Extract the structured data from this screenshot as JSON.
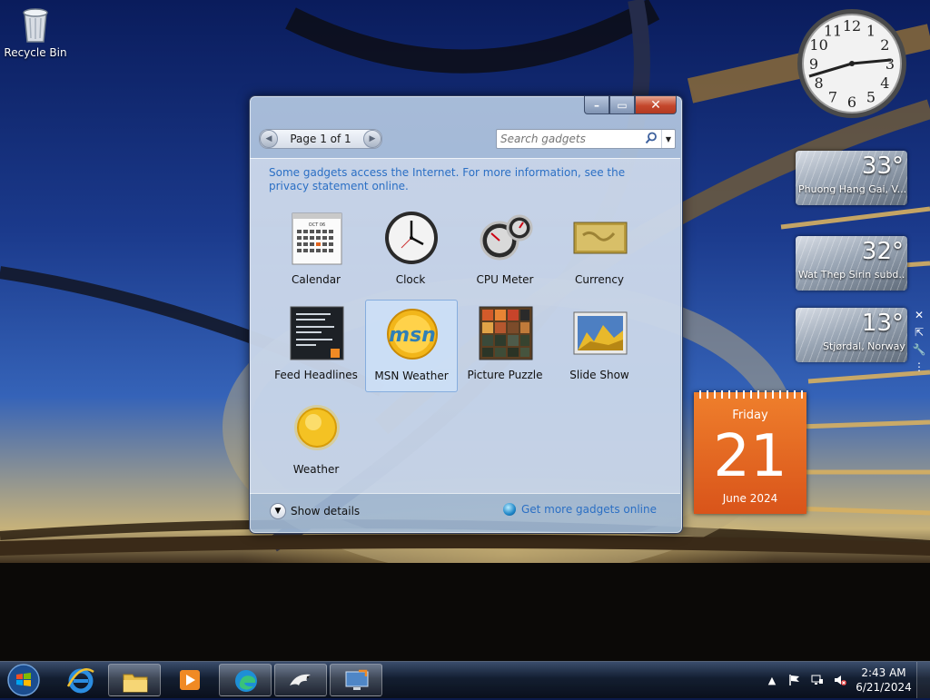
{
  "desktop": {
    "icons": [
      {
        "label": "Recycle Bin",
        "icon": "recycle-bin-icon"
      }
    ]
  },
  "gallery": {
    "caption": {
      "minimize": "–",
      "maximize": "▭",
      "close": "✕"
    },
    "pager": {
      "label": "Page 1 of 1",
      "prev": "◀",
      "next": "▶"
    },
    "search": {
      "placeholder": "Search gadgets",
      "dropdown": "▼"
    },
    "notice": "Some gadgets access the Internet.  For more information, see the privacy statement online.",
    "gadgets": [
      {
        "name": "Calendar",
        "icon": "calendar-gadget-icon"
      },
      {
        "name": "Clock",
        "icon": "clock-gadget-icon"
      },
      {
        "name": "CPU Meter",
        "icon": "cpu-meter-gadget-icon"
      },
      {
        "name": "Currency",
        "icon": "currency-gadget-icon"
      },
      {
        "name": "Feed Headlines",
        "icon": "feed-headlines-gadget-icon"
      },
      {
        "name": "MSN Weather",
        "icon": "msn-weather-gadget-icon",
        "selected": true
      },
      {
        "name": "Picture Puzzle",
        "icon": "picture-puzzle-gadget-icon"
      },
      {
        "name": "Slide Show",
        "icon": "slide-show-gadget-icon"
      },
      {
        "name": "Weather",
        "icon": "weather-gadget-icon"
      }
    ],
    "cal_thumb_label": "OCT 06",
    "msn_logo": "msn",
    "footer": {
      "show_details": "Show details",
      "more_gadgets": "Get more gadgets online"
    }
  },
  "sidebar": {
    "clock": {
      "numbers": [
        "12",
        "1",
        "2",
        "3",
        "4",
        "5",
        "6",
        "7",
        "8",
        "9",
        "10",
        "11"
      ]
    },
    "weather": [
      {
        "temp": "33°",
        "location": "Phuong Hang Gai, V..."
      },
      {
        "temp": "32°",
        "location": "Wat Thep Sirin subd..."
      },
      {
        "temp": "13°",
        "location": "Stjørdal, Norway"
      }
    ],
    "toolbar": {
      "close": "✕",
      "larger": "⇱",
      "options": "🔧"
    },
    "calendar": {
      "weekday": "Friday",
      "day": "21",
      "month_year": "June 2024"
    }
  },
  "taskbar": {
    "apps": [
      {
        "name": "Internet Explorer",
        "icon": "internet-explorer-icon"
      },
      {
        "name": "Windows Explorer",
        "icon": "folder-icon",
        "active": true
      },
      {
        "name": "Windows Media Player",
        "icon": "media-player-icon"
      },
      {
        "name": "Microsoft Edge",
        "icon": "edge-icon",
        "active": true
      },
      {
        "name": "Eagle app",
        "icon": "eagle-icon",
        "active": true
      },
      {
        "name": "Remote Desktop",
        "icon": "remote-desktop-icon",
        "active": true
      }
    ],
    "tray": {
      "show_hidden": "▲",
      "time": "2:43 AM",
      "date": "6/21/2024"
    }
  },
  "colors": {
    "link": "#2b6fc4",
    "calendar_orange": "#e2651f"
  }
}
